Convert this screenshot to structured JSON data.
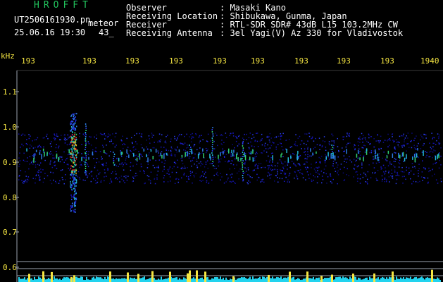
{
  "app": {
    "title": "HROFFT"
  },
  "header": {
    "filename": "UT2506161930.pn",
    "detector": "meteor",
    "datetime": "25.06.16 19:30",
    "count": "43_",
    "fields": [
      {
        "label": "Observer",
        "value": ": Masaki Kano"
      },
      {
        "label": "Receiving Location",
        "value": ": Shibukawa, Gunma, Japan"
      },
      {
        "label": "Receiver",
        "value": ": RTL-SDR SDR# 43dB L15 103.2MHz CW"
      },
      {
        "label": "Receiving Antenna",
        "value": ": 3el Yagi(V) Az 330 for Vladivostok"
      }
    ]
  },
  "axes": {
    "y_unit": "kHz",
    "y_ticks": [
      "1.1",
      "1.0",
      "0.9",
      "0.8",
      "0.7",
      "0.6"
    ],
    "x_ticks": [
      "193",
      "193",
      "193",
      "193",
      "193",
      "193",
      "193",
      "193",
      "193",
      "1940"
    ]
  },
  "colors": {
    "background": "#000000",
    "title": "#22c55e",
    "tick_labels": "#f5e642",
    "axis": "#9ca3af",
    "strip_yellow": "#f5e642",
    "strip_cyan": "#22d3ee"
  }
}
